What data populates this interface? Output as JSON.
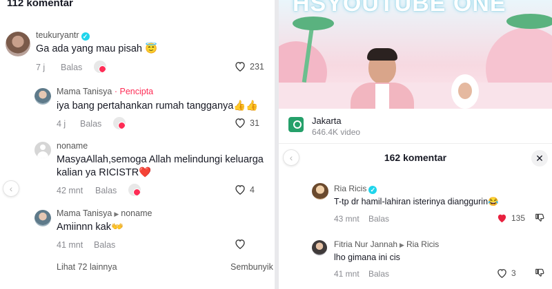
{
  "left": {
    "header_count": "112 komentar",
    "comments": [
      {
        "username": "teukuryantr",
        "verified": true,
        "text": "Ga ada yang mau pisah 😇",
        "time": "7 j",
        "reply": "Balas",
        "likes": "231"
      },
      {
        "username": "Mama Tanisya",
        "creator_tag": "· Pencipta",
        "text": "iya bang pertahankan rumah tangganya👍👍",
        "time": "4 j",
        "reply": "Balas",
        "likes": "31"
      },
      {
        "username": "noname",
        "text_line1": "MasyaAllah,semoga Allah melindungi keluarga",
        "text_line2": "kalian ya RICISTR❤️",
        "time": "42 mnt",
        "reply": "Balas",
        "likes": "4"
      },
      {
        "username": "Mama Tanisya",
        "reply_to": "noname",
        "text": "Amiinnn kak👐",
        "time": "41 mnt",
        "reply": "Balas"
      }
    ],
    "see_more": "Lihat 72 lainnya",
    "hide": "Sembunyik"
  },
  "right": {
    "video_banner_text": "HSYOUTUBE ONE",
    "location_name": "Jakarta",
    "location_sub": "646.4K video",
    "comments_title": "162 komentar",
    "comments": [
      {
        "username": "Ria Ricis",
        "verified": true,
        "text": "T-tp dr hamil-lahiran isterinya dianggurin😂",
        "time": "43 mnt",
        "reply": "Balas",
        "likes": "135"
      },
      {
        "username": "Fitria Nur Jannah",
        "reply_to": "Ria Ricis",
        "text": "lho gimana ini cis",
        "time": "41 mnt",
        "reply": "Balas",
        "likes": "3"
      }
    ]
  },
  "colors": {
    "accent": "#fe2c55",
    "verified": "#20d5ec",
    "muted": "#8a8b91"
  },
  "icons": [
    "heart-icon",
    "heart-filled-icon",
    "dislike-icon",
    "verified-icon",
    "location-pin-icon",
    "close-icon",
    "chevron-left-icon"
  ]
}
